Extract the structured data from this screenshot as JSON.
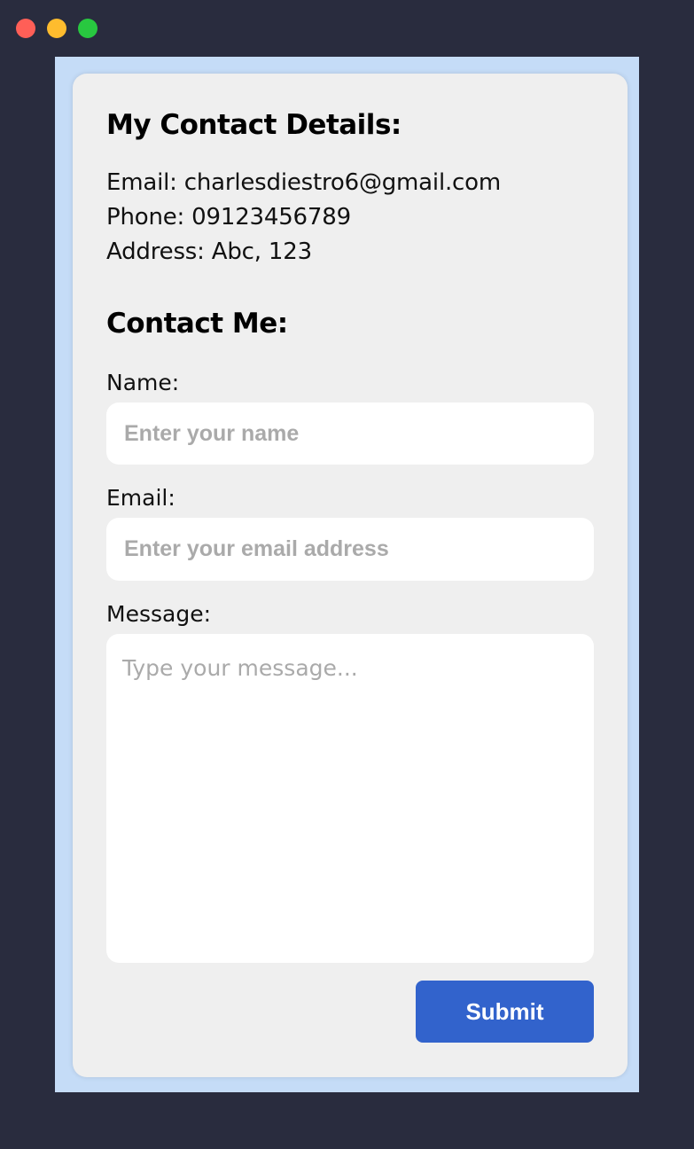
{
  "window_controls": {
    "close_color": "#ff5f57",
    "minimize_color": "#febc2e",
    "maximize_color": "#28c840"
  },
  "details": {
    "heading": "My Contact Details:",
    "email": "Email: charlesdiestro6@gmail.com",
    "phone": "Phone: 09123456789",
    "address": "Address: Abc, 123"
  },
  "form": {
    "heading": "Contact Me:",
    "name_label": "Name:",
    "name_placeholder": "Enter your name",
    "email_label": "Email:",
    "email_placeholder": "Enter your email address",
    "message_label": "Message:",
    "message_placeholder": "Type your message...",
    "submit_label": "Submit"
  },
  "colors": {
    "page_background": "#292c3e",
    "frame_background": "#c5dcf7",
    "card_background": "#efefef",
    "accent": "#3263cc"
  }
}
